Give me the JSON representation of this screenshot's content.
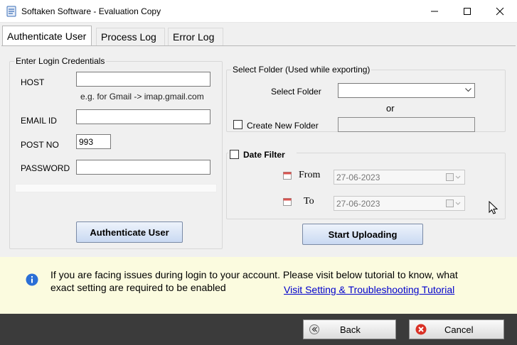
{
  "window": {
    "title": "Softaken Software - Evaluation Copy"
  },
  "tabs": [
    {
      "label": "Authenticate User",
      "active": true
    },
    {
      "label": "Process Log",
      "active": false
    },
    {
      "label": "Error Log",
      "active": false
    }
  ],
  "login": {
    "legend": "Enter Login Credentials",
    "host_label": "HOST",
    "host_value": "",
    "host_hint": "e.g. for Gmail -> imap.gmail.com",
    "email_label": "EMAIL ID",
    "email_value": "",
    "port_label": "POST NO",
    "port_value": "993",
    "password_label": "PASSWORD",
    "password_value": ""
  },
  "folder": {
    "legend": "Select Folder (Used while exporting)",
    "select_label": "Select Folder",
    "select_value": "",
    "or_text": "or",
    "create_label": "Create New Folder",
    "create_checked": false,
    "new_folder_value": ""
  },
  "date_filter": {
    "label": "Date Filter",
    "checked": false,
    "from_label": "From",
    "from_value": "27-06-2023",
    "to_label": "To",
    "to_value": "27-06-2023"
  },
  "buttons": {
    "authenticate": "Authenticate User",
    "start_uploading": "Start Uploading",
    "back": "Back",
    "cancel": "Cancel"
  },
  "info": {
    "message": "If you are facing issues during login to your account. Please visit below tutorial to know, what exact setting are required to be enabled",
    "link": "Visit Setting & Troubleshooting Tutorial"
  },
  "colors": {
    "info_bg": "#fbfbdf",
    "footer_bg": "#3b3b3b",
    "link": "#0000cc",
    "info_icon": "#2b6fd6"
  }
}
